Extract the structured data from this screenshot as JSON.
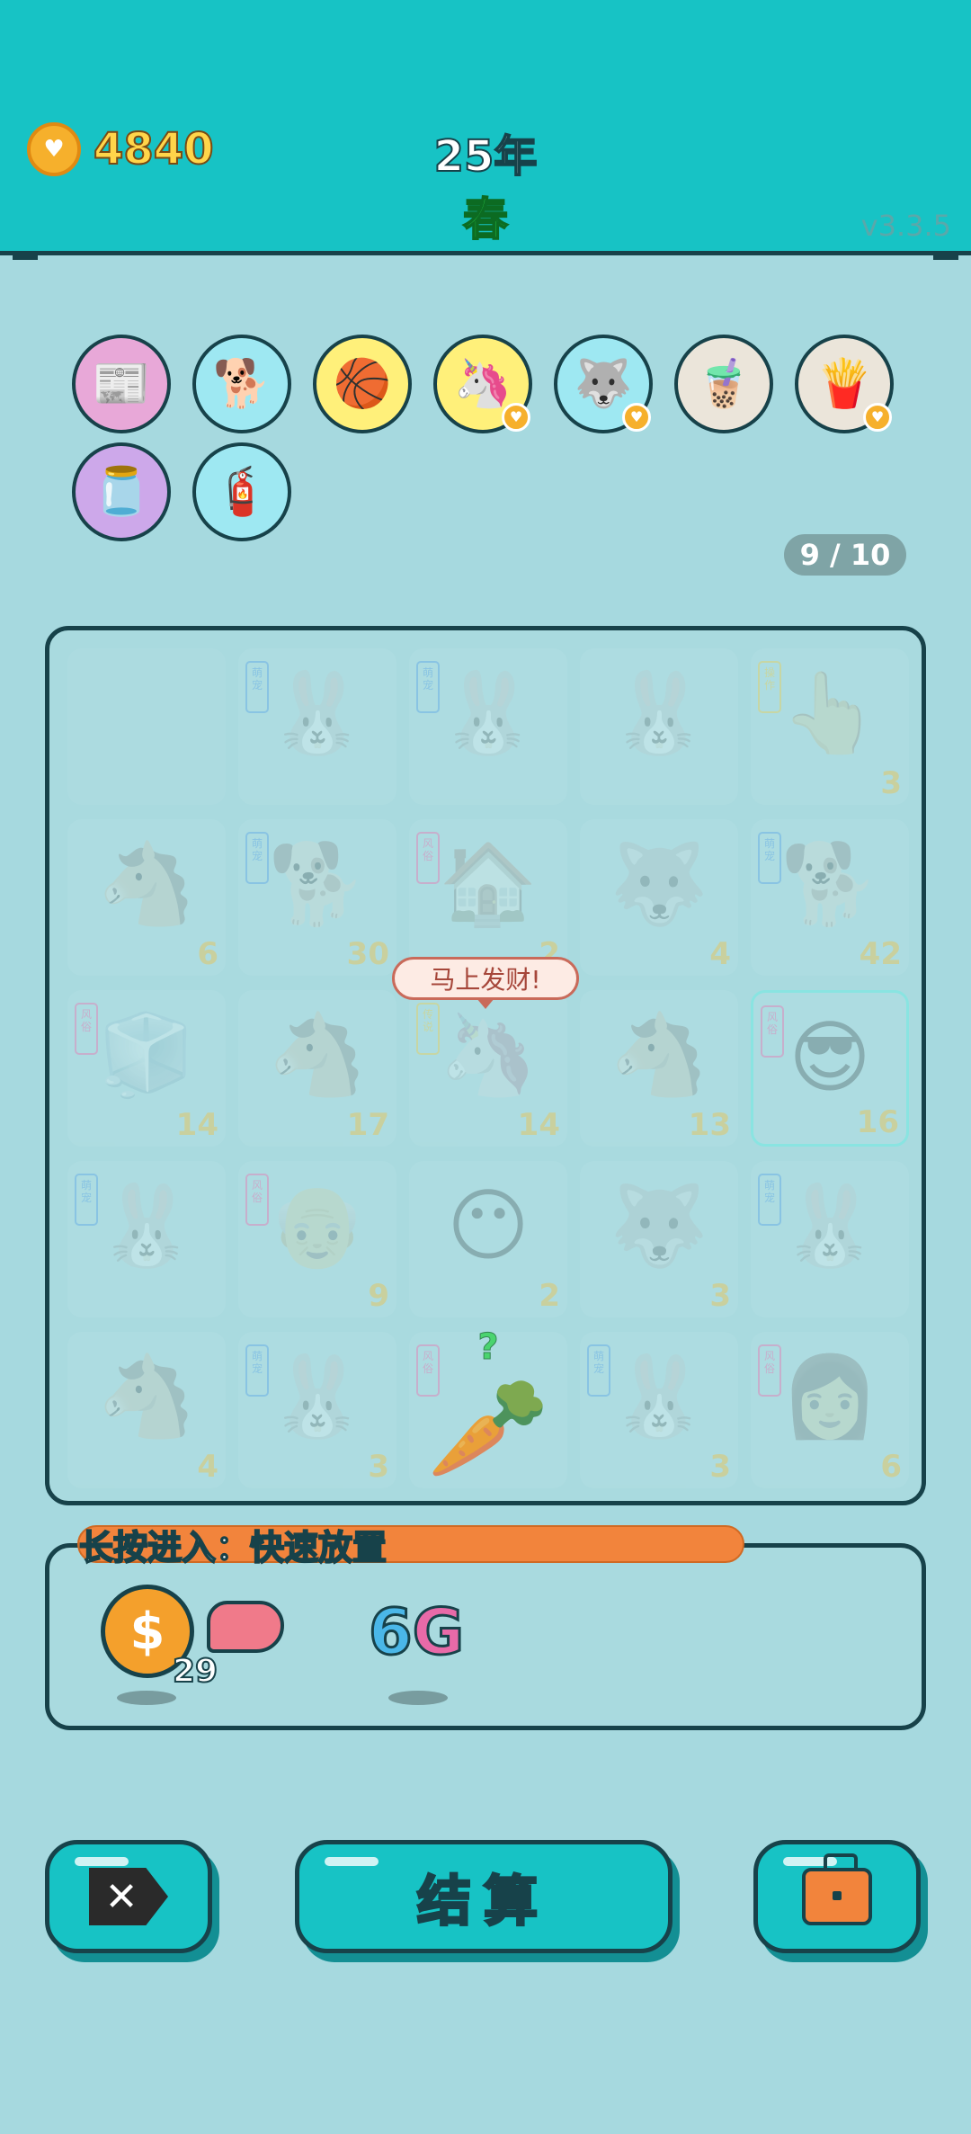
{
  "header": {
    "coins": "4840",
    "coin_icon": "heart-coin-icon",
    "year": "25年",
    "season": "春",
    "version": "v3.3.5"
  },
  "collection": {
    "items": [
      {
        "name": "time-magazine-icon",
        "glyph": "📰",
        "bg": "#e8a8d8",
        "badge": false
      },
      {
        "name": "cool-dog-icon",
        "glyph": "🐕",
        "bg": "#9ee8f2",
        "badge": false
      },
      {
        "name": "basketballs-icon",
        "glyph": "🏀",
        "bg": "#fff07a",
        "badge": false
      },
      {
        "name": "unicorn-icon",
        "glyph": "🦄",
        "bg": "#fff07a",
        "badge": true
      },
      {
        "name": "husky-icon",
        "glyph": "🐺",
        "bg": "#9ee8f2",
        "badge": true
      },
      {
        "name": "bubble-tea-icon",
        "glyph": "🧋",
        "bg": "#ebe5da",
        "badge": false
      },
      {
        "name": "french-fries-icon",
        "glyph": "🍟",
        "bg": "#ebe5da",
        "badge": true
      },
      {
        "name": "jar-icon",
        "glyph": "🫙",
        "bg": "#cda8ea",
        "badge": false
      },
      {
        "name": "bike-pump-icon",
        "glyph": "🧯",
        "bg": "#9ee8f2",
        "badge": false
      }
    ],
    "count": "9 / 10"
  },
  "board": {
    "cells": [
      {
        "pic": "",
        "tag": "",
        "tagc": "",
        "num": "",
        "name": "empty-cell"
      },
      {
        "pic": "🐰",
        "tag": "萌宠",
        "tagc": "t-blue",
        "num": "",
        "name": "rabbit-icon"
      },
      {
        "pic": "🐰",
        "tag": "萌宠",
        "tagc": "t-blue",
        "num": "",
        "name": "rabbit-icon"
      },
      {
        "pic": "🐰",
        "tag": "",
        "tagc": "",
        "num": "",
        "name": "rabbit-icon"
      },
      {
        "pic": "👆",
        "tag": "操作",
        "tagc": "t-yellow",
        "num": "3",
        "name": "pointing-hand-icon"
      },
      {
        "pic": "🐴",
        "tag": "",
        "tagc": "",
        "num": "6",
        "name": "horse-icon"
      },
      {
        "pic": "🐕",
        "tag": "萌宠",
        "tagc": "t-blue",
        "num": "30",
        "name": "husky-icon"
      },
      {
        "pic": "🏠",
        "tag": "风俗",
        "tagc": "t-pink",
        "num": "2",
        "name": "windmill-house-icon"
      },
      {
        "pic": "🐺",
        "tag": "",
        "tagc": "",
        "num": "4",
        "name": "husky-icon"
      },
      {
        "pic": "🐕",
        "tag": "萌宠",
        "tagc": "t-blue",
        "num": "42",
        "name": "husky-icon"
      },
      {
        "pic": "🧊",
        "tag": "风俗",
        "tagc": "t-pink",
        "num": "14",
        "name": "fan-box-icon"
      },
      {
        "pic": "🐴",
        "tag": "",
        "tagc": "",
        "num": "17",
        "name": "horse-icon"
      },
      {
        "pic": "🦄",
        "tag": "传说",
        "tagc": "t-yellow",
        "num": "14",
        "name": "unicorn-icon"
      },
      {
        "pic": "🐴",
        "tag": "",
        "tagc": "",
        "num": "13",
        "name": "horse-icon"
      },
      {
        "pic": "😎",
        "tag": "风俗",
        "tagc": "t-pink",
        "num": "16",
        "name": "sunglasses-face-icon",
        "selected": true
      },
      {
        "pic": "🐰",
        "tag": "萌宠",
        "tagc": "t-blue",
        "num": "",
        "name": "rabbit-icon"
      },
      {
        "pic": "👴",
        "tag": "风俗",
        "tagc": "t-pink",
        "num": "9",
        "name": "old-man-face-icon"
      },
      {
        "pic": "😶",
        "tag": "",
        "tagc": "",
        "num": "2",
        "name": "face-icon"
      },
      {
        "pic": "🐺",
        "tag": "",
        "tagc": "",
        "num": "3",
        "name": "husky-icon"
      },
      {
        "pic": "🐰",
        "tag": "萌宠",
        "tagc": "t-blue",
        "num": "",
        "name": "rabbit-icon"
      },
      {
        "pic": "🐴",
        "tag": "",
        "tagc": "",
        "num": "4",
        "name": "horse-icon"
      },
      {
        "pic": "🐰",
        "tag": "萌宠",
        "tagc": "t-blue",
        "num": "3",
        "name": "rabbit-icon"
      },
      {
        "pic": "🥕",
        "tag": "风俗",
        "tagc": "t-pink",
        "num": "",
        "name": "carrot-icon",
        "active": true,
        "mark": "?"
      },
      {
        "pic": "🐰",
        "tag": "萌宠",
        "tagc": "t-blue",
        "num": "3",
        "name": "rabbit-icon"
      },
      {
        "pic": "👩",
        "tag": "风俗",
        "tagc": "t-pink",
        "num": "6",
        "name": "girl-face-icon"
      }
    ],
    "speech_bubble": "马上发财!"
  },
  "panel": {
    "progress_label": "长按进入：快速放置",
    "dollar_count": "29",
    "sixg_six": "6",
    "sixg_g": "G"
  },
  "buttons": {
    "exit_label": "✕",
    "settle_label": "结算"
  },
  "colors": {
    "header": "#17c3c5",
    "background": "#a6d9df",
    "outline": "#17424a",
    "progress": "#f2843c"
  }
}
